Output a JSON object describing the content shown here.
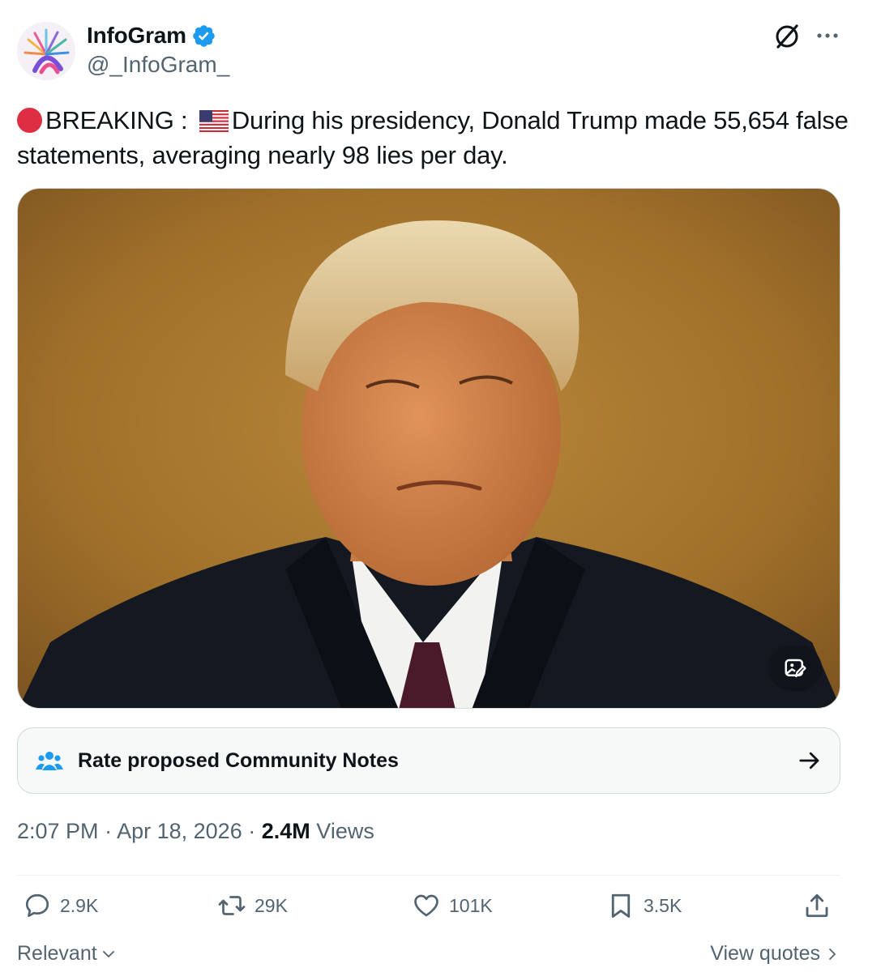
{
  "author": {
    "display_name": "InfoGram",
    "handle": "@_InfoGram_",
    "verified": true
  },
  "tweet": {
    "prefix_emoji": "red-circle-icon",
    "breaking_label": "BREAKING :",
    "flag_emoji": "us-flag-icon",
    "body": "During his presidency, Donald Trump made 55,654 false statements, averaging nearly 98 lies per day."
  },
  "media": {
    "alt_icon": "image-edit-icon"
  },
  "community_notes": {
    "label": "Rate proposed Community Notes"
  },
  "meta": {
    "time": "2:07 PM",
    "separator1": "·",
    "date": "Apr 18, 2026",
    "separator2": "·",
    "views_count": "2.4M",
    "views_label": "Views"
  },
  "actions": {
    "replies": "2.9K",
    "reposts": "29K",
    "likes": "101K",
    "bookmarks": "3.5K"
  },
  "footer": {
    "sort_label": "Relevant",
    "view_quotes_label": "View quotes"
  },
  "colors": {
    "text_primary": "#0f1419",
    "text_secondary": "#536471",
    "verified_blue": "#1d9bf0",
    "border": "#cfd9de"
  }
}
